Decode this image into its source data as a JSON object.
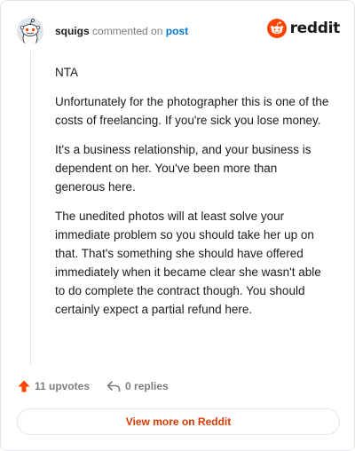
{
  "comment": {
    "username": "squigs",
    "action_text": "commented on",
    "post_link": "post",
    "paragraphs": [
      "NTA",
      "Unfortunately for the photographer this is one of the costs of freelancing. If you're sick you lose money.",
      "It's a business relationship, and your business is dependent on her. You've been more than generous here.",
      "The unedited photos will at least solve your immediate problem so you should take her up on that. That's something she should have offered immediately when it became clear she wasn't able to do complete the contract though. You should certainly expect a partial refund here."
    ],
    "upvotes_label": "11 upvotes",
    "replies_label": "0 replies"
  },
  "branding": {
    "logo_text": "reddit",
    "brand_color": "#ff4500"
  },
  "footer": {
    "view_more_label": "View more on Reddit",
    "link_color": "#d93a00"
  },
  "icons": [
    "avatar",
    "reddit-logo-icon",
    "upvote-arrow-icon",
    "reply-arrow-icon"
  ]
}
